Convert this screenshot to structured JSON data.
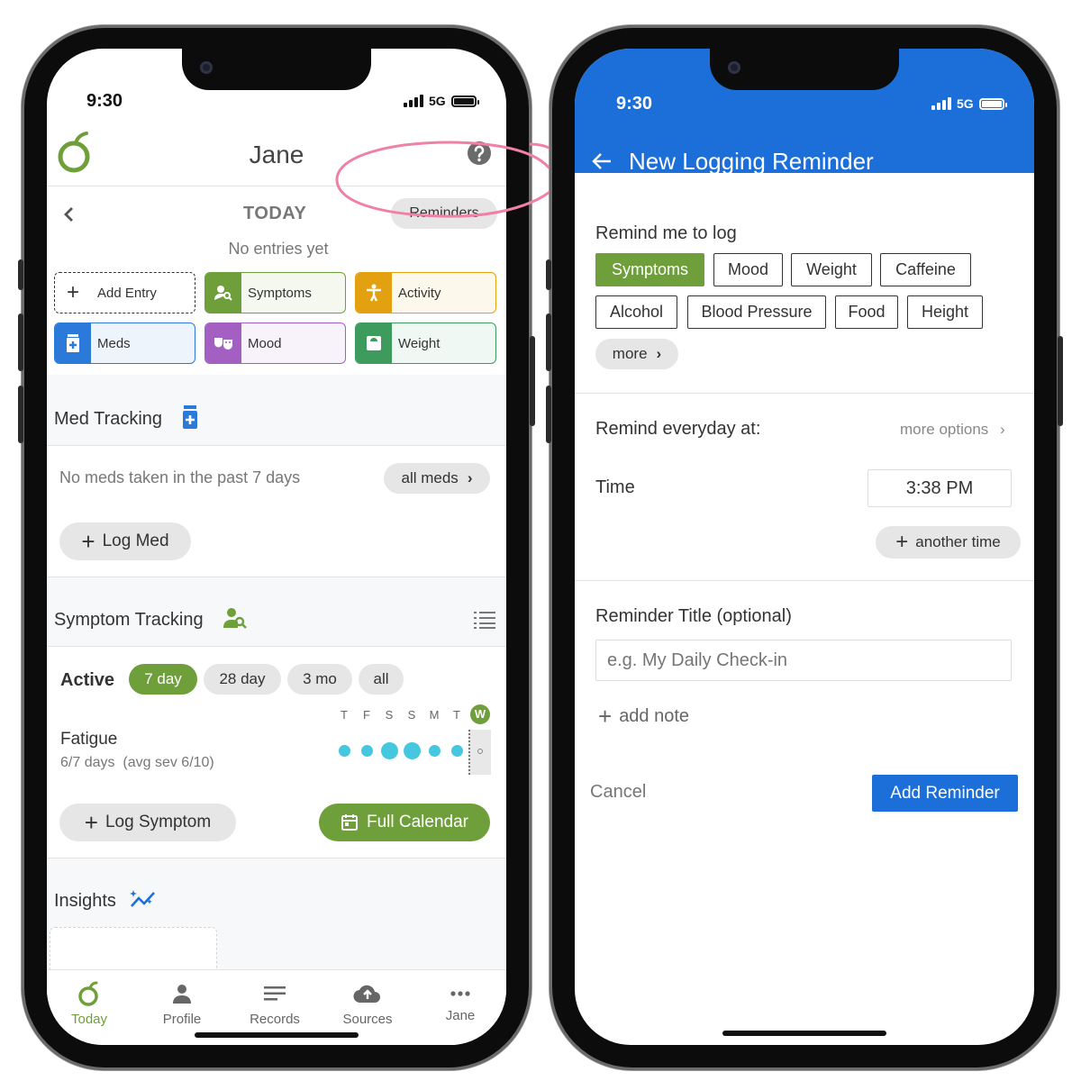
{
  "status": {
    "time": "9:30",
    "network": "5G"
  },
  "left": {
    "header": {
      "title": "Jane",
      "logo": "oval-leaf-logo",
      "help_icon": "question-circle-icon"
    },
    "today": {
      "label": "TODAY",
      "reminders_button": "Reminders",
      "empty_text": "No entries yet"
    },
    "tiles": [
      {
        "label": "Add Entry",
        "icon": "plus-icon",
        "color": "#ffffff"
      },
      {
        "label": "Symptoms",
        "icon": "person-search-icon",
        "color": "#6e9f3a"
      },
      {
        "label": "Activity",
        "icon": "person-standing-icon",
        "color": "#e3a112"
      },
      {
        "label": "Meds",
        "icon": "medicine-bottle-icon",
        "color": "#2b79d8"
      },
      {
        "label": "Mood",
        "icon": "masks-icon",
        "color": "#a35fc2"
      },
      {
        "label": "Weight",
        "icon": "scale-icon",
        "color": "#3d9b5d"
      }
    ],
    "med_tracking": {
      "title": "Med Tracking",
      "empty_text": "No meds taken in the past 7 days",
      "all_meds_button": "all meds",
      "log_button": "Log Med"
    },
    "symptom_tracking": {
      "title": "Symptom Tracking",
      "active_label": "Active",
      "ranges": [
        "7 day",
        "28 day",
        "3 mo",
        "all"
      ],
      "selected_range": "7 day",
      "days": [
        "T",
        "F",
        "S",
        "S",
        "M",
        "T",
        "W"
      ],
      "symptom": {
        "name": "Fatigue",
        "detail": "6/7 days  (avg sev 6/10)"
      },
      "log_button": "Log Symptom",
      "calendar_button": "Full Calendar"
    },
    "insights": {
      "title": "Insights"
    },
    "nav": [
      {
        "label": "Today",
        "icon": "oval-leaf-icon",
        "active": true
      },
      {
        "label": "Profile",
        "icon": "person-icon"
      },
      {
        "label": "Records",
        "icon": "lines-icon"
      },
      {
        "label": "Sources",
        "icon": "cloud-upload-icon"
      },
      {
        "label": "Jane",
        "icon": "more-dots-icon"
      }
    ]
  },
  "right": {
    "header": {
      "title": "New Logging Reminder",
      "color": "#1c6fd8"
    },
    "remind_label": "Remind me to log",
    "categories": [
      "Symptoms",
      "Mood",
      "Weight",
      "Caffeine",
      "Alcohol",
      "Blood Pressure",
      "Food",
      "Height"
    ],
    "selected_category": "Symptoms",
    "more_button": "more",
    "remind_everyday": "Remind everyday at:",
    "more_options": "more options",
    "time_label": "Time",
    "time_value": "3:38 PM",
    "another_time": "another time",
    "title_label": "Reminder Title (optional)",
    "title_placeholder": "e.g. My Daily Check-in",
    "add_note": "add note",
    "cancel": "Cancel",
    "add_reminder": "Add Reminder"
  },
  "colors": {
    "green": "#6e9f3a",
    "blue": "#1c6fd8",
    "highlight_circle": "#f080a8"
  }
}
